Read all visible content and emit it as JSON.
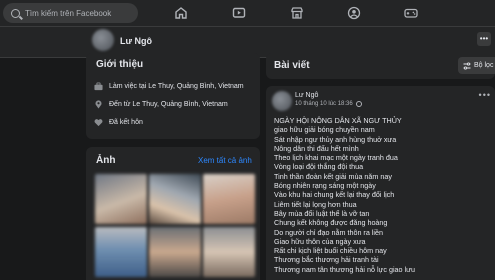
{
  "topbar": {
    "search_placeholder": "Tìm kiếm trên Facebook",
    "nav_icons": [
      "home-icon",
      "watch-icon",
      "marketplace-icon",
      "groups-icon",
      "gaming-icon"
    ]
  },
  "profile": {
    "name": "Lư Ngô"
  },
  "intro": {
    "title": "Giới thiệu",
    "items": [
      {
        "icon": "briefcase-icon",
        "text": "Làm việc tại Le Thuy, Quảng Bình, Vietnam"
      },
      {
        "icon": "location-icon",
        "text": "Đến từ Le Thuy, Quảng Bình, Vietnam"
      },
      {
        "icon": "heart-icon",
        "text": "Đã kết hôn"
      }
    ]
  },
  "photos": {
    "title": "Ảnh",
    "see_all": "Xem tất cả ảnh"
  },
  "posts": {
    "title": "Bài viết",
    "filter_label": "Bộ lọc"
  },
  "post": {
    "author": "Lư Ngô",
    "date": "10 tháng 10 lúc 18:36",
    "lines": [
      "NGÀY HỘI NÔNG DÂN XÃ NGƯ THỦY",
      "giao hữu giải bóng chuyền nam",
      "Sát nhập ngư thủy anh hùng thuở xưa",
      "Nông dân thi đấu hết mình",
      "Theo lịch khai mạc một ngày tranh đua",
      "Vòng loại đội thắng đội thua",
      "Tinh thần đoàn kết giải mùa năm nay",
      "Bóng nhiên rạng sáng một ngày",
      "Vào khu hai chung kết lại thay đổi lịch",
      "Liêm tiết lại lọng hơn thua",
      "Bây mùa đổi luật thể là vỡ tan",
      "Chung kết không được đăng hoàng",
      "Do người chỉ đạo nằm thôn ra liền",
      "Giao hữu thôn của ngày xưa",
      "Rất chi kịch liệt buổi chiều hôm nay",
      "Thương bắc thương hải tranh tài",
      "Thương nam tân thương hải nỗ lực giao lưu"
    ]
  },
  "colors": {
    "background": "#18191a",
    "card": "#242526",
    "link": "#2d88ff",
    "text": "#e4e6eb",
    "muted": "#b0b3b8"
  }
}
